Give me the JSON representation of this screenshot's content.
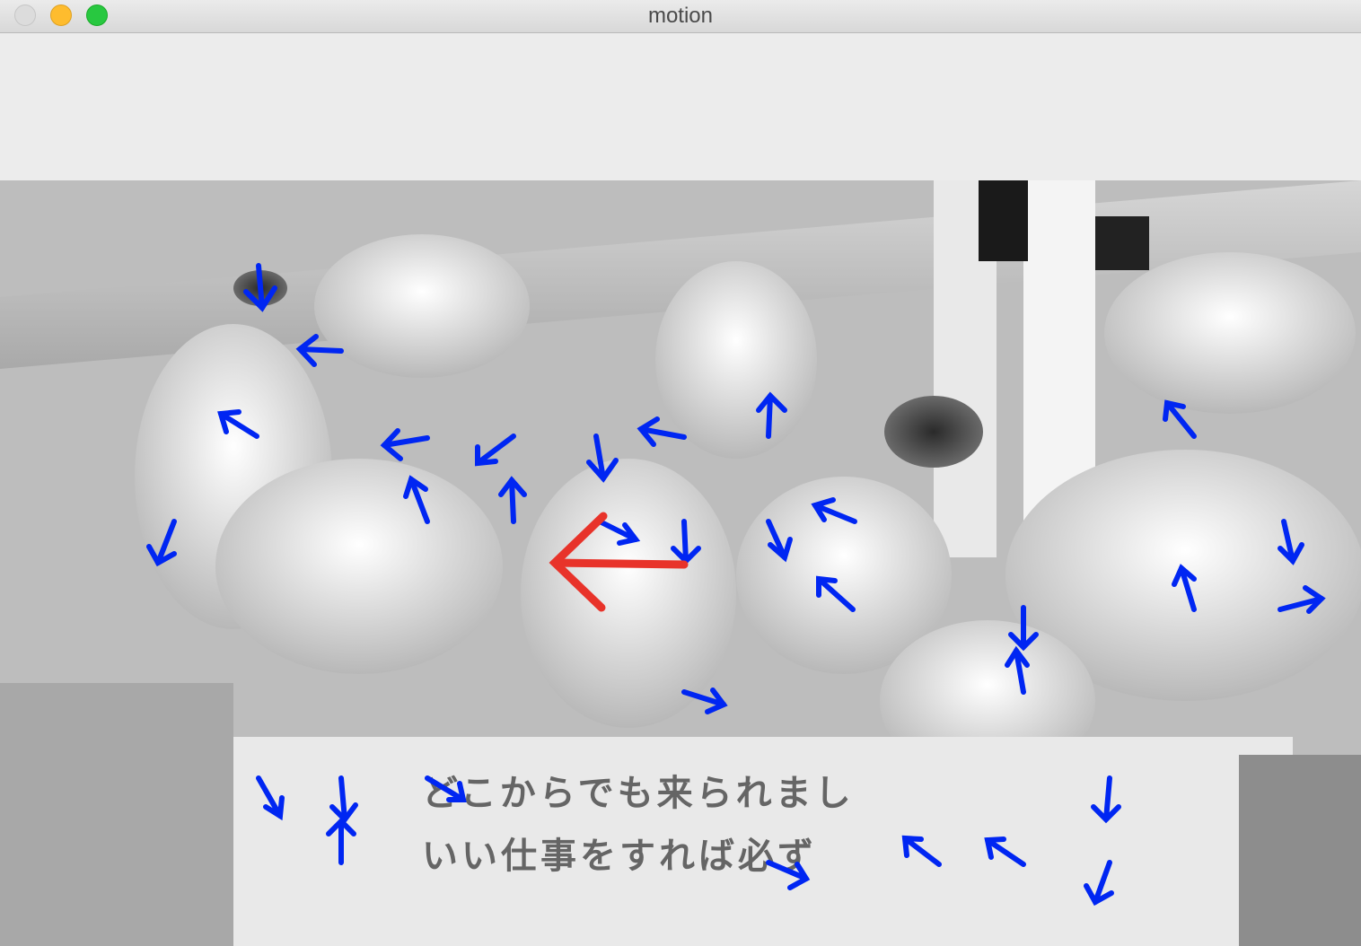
{
  "window": {
    "title": "motion",
    "buttons": [
      "close",
      "minimize",
      "maximize"
    ]
  },
  "frame": {
    "description_icon": "depth-map-image",
    "sign_lines": [
      "どこからでも来られまし",
      "いい仕事をすれば必ず"
    ]
  },
  "colors": {
    "flow_arrow": "#0026f2",
    "main_arrow": "#e8332a"
  },
  "main_motion": {
    "direction": "left"
  }
}
